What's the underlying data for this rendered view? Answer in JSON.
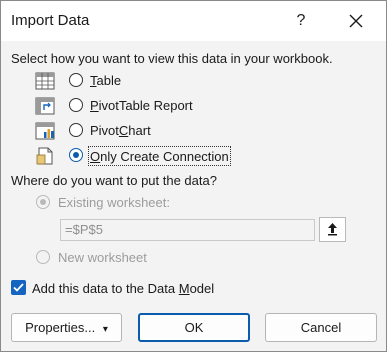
{
  "dialog": {
    "title": "Import Data",
    "help_label": "?",
    "prompt_view": "Select how you want to view this data in your workbook.",
    "views": [
      {
        "pre": "",
        "key": "T",
        "post": "able",
        "checked": false
      },
      {
        "pre": "",
        "key": "P",
        "post": "ivotTable Report",
        "checked": false
      },
      {
        "pre": "Pivot",
        "key": "C",
        "post": "hart",
        "checked": false
      },
      {
        "pre": "",
        "key": "O",
        "post": "nly Create Connection",
        "checked": true
      }
    ],
    "prompt_location": "Where do you want to put the data?",
    "existing_label": "Existing worksheet:",
    "existing_value": "=$P$5",
    "new_label": "New worksheet",
    "datamodel": {
      "pre": "Add this data to the Data ",
      "key": "M",
      "post": "odel",
      "checked": true
    },
    "buttons": {
      "properties": "Properties...",
      "properties_arrow": "▾",
      "ok": "OK",
      "cancel": "Cancel"
    }
  }
}
